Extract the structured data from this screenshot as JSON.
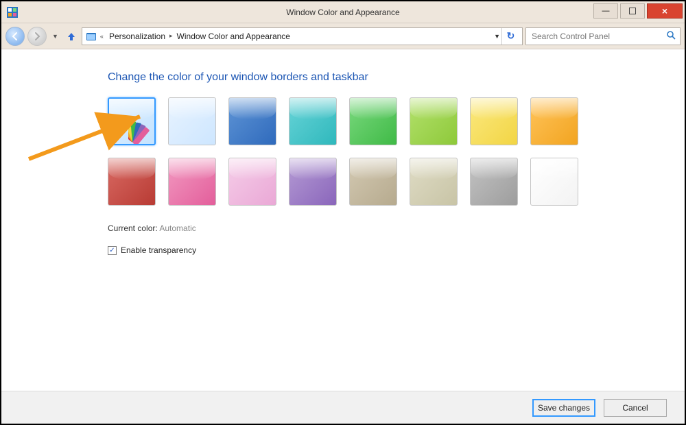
{
  "window": {
    "title": "Window Color and Appearance"
  },
  "breadcrumb": {
    "items": [
      "Personalization",
      "Window Color and Appearance"
    ]
  },
  "search": {
    "placeholder": "Search Control Panel"
  },
  "page": {
    "heading": "Change the color of your window borders and taskbar",
    "current_color_label": "Current color:",
    "current_color_value": "Automatic",
    "transparency_label": "Enable transparency",
    "transparency_checked": true
  },
  "swatches": [
    {
      "name": "automatic",
      "color1": "#dff0ff",
      "color2": "#c4e3ff",
      "selected": true,
      "has_fan": true
    },
    {
      "name": "light-blue",
      "color1": "#e8f3ff",
      "color2": "#cde6ff",
      "selected": false,
      "has_fan": false
    },
    {
      "name": "blue",
      "color1": "#5f95d6",
      "color2": "#2f6abc",
      "selected": false,
      "has_fan": false
    },
    {
      "name": "teal",
      "color1": "#68d4d8",
      "color2": "#2fb8bc",
      "selected": false,
      "has_fan": false
    },
    {
      "name": "green",
      "color1": "#7bd97f",
      "color2": "#3fba46",
      "selected": false,
      "has_fan": false
    },
    {
      "name": "lime",
      "color1": "#b3e16c",
      "color2": "#8ec93a",
      "selected": false,
      "has_fan": false
    },
    {
      "name": "yellow",
      "color1": "#fbe980",
      "color2": "#f2d544",
      "selected": false,
      "has_fan": false
    },
    {
      "name": "orange",
      "color1": "#ffc45b",
      "color2": "#f2a420",
      "selected": false,
      "has_fan": false
    },
    {
      "name": "red",
      "color1": "#d96a63",
      "color2": "#b83b34",
      "selected": false,
      "has_fan": false
    },
    {
      "name": "hot-pink",
      "color1": "#f29ac1",
      "color2": "#e35e9b",
      "selected": false,
      "has_fan": false
    },
    {
      "name": "light-pink",
      "color1": "#f5cde8",
      "color2": "#eaa8d6",
      "selected": false,
      "has_fan": false
    },
    {
      "name": "purple",
      "color1": "#b59bd4",
      "color2": "#8a66bb",
      "selected": false,
      "has_fan": false
    },
    {
      "name": "taupe",
      "color1": "#d3c9b2",
      "color2": "#b6aa8e",
      "selected": false,
      "has_fan": false
    },
    {
      "name": "khaki",
      "color1": "#dfdcc5",
      "color2": "#c8c4a6",
      "selected": false,
      "has_fan": false
    },
    {
      "name": "gray",
      "color1": "#c3c3c3",
      "color2": "#9d9d9d",
      "selected": false,
      "has_fan": false
    },
    {
      "name": "white",
      "color1": "#ffffff",
      "color2": "#f3f3f3",
      "selected": false,
      "has_fan": false
    }
  ],
  "buttons": {
    "save": "Save changes",
    "cancel": "Cancel"
  }
}
